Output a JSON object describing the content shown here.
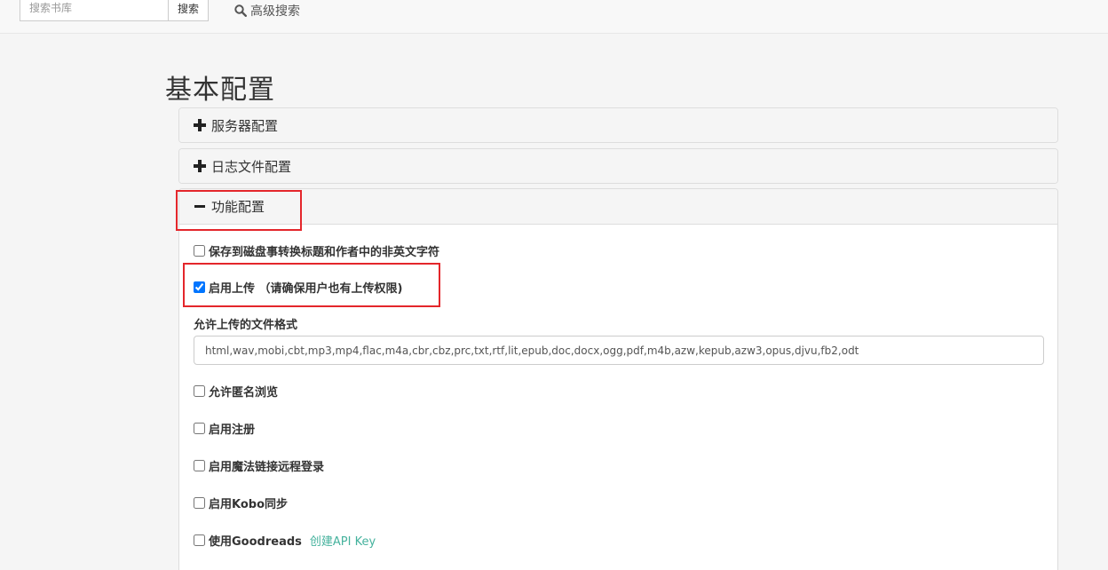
{
  "topbar": {
    "search_placeholder": "搜索书库",
    "search_button": "搜索",
    "advanced_search": "高级搜索"
  },
  "page": {
    "title": "基本配置"
  },
  "panels": [
    {
      "label": "服务器配置",
      "expanded": false
    },
    {
      "label": "日志文件配置",
      "expanded": false
    },
    {
      "label": "功能配置",
      "expanded": true
    }
  ],
  "feature_config": {
    "convert_non_english": {
      "label": "保存到磁盘事转换标题和作者中的非英文字符",
      "checked": false
    },
    "enable_upload": {
      "label": "启用上传 （请确保用户也有上传权限)",
      "checked": true
    },
    "allowed_formats_label": "允许上传的文件格式",
    "allowed_formats_value": "html,wav,mobi,cbt,mp3,mp4,flac,m4a,cbr,cbz,prc,txt,rtf,lit,epub,doc,docx,ogg,pdf,m4b,azw,kepub,azw3,opus,djvu,fb2,odt",
    "anonymous_browse": {
      "label": "允许匿名浏览",
      "checked": false
    },
    "enable_register": {
      "label": "启用注册",
      "checked": false
    },
    "magic_link": {
      "label": "启用魔法链接远程登录",
      "checked": false
    },
    "kobo_sync": {
      "label": "启用Kobo同步",
      "checked": false
    },
    "goodreads": {
      "label": "使用Goodreads",
      "checked": false,
      "link": "创建API Key"
    }
  },
  "colors": {
    "accent_link": "#45b29d",
    "highlight_box": "#e4262b"
  }
}
